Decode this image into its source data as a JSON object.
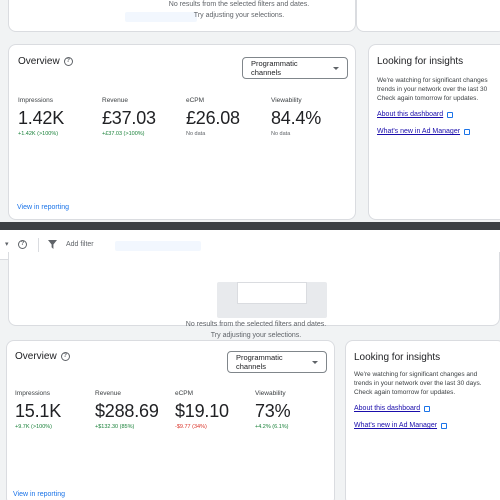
{
  "top": {
    "empty_state": {
      "line1": "No results from the selected filters and dates.",
      "line2": "Try adjusting your selections."
    },
    "overview": {
      "title": "Overview",
      "channel_select": "Programmatic channels",
      "metrics": [
        {
          "label": "Impressions",
          "value": "1.42K",
          "delta": "+1.42K (>100%)",
          "tone": "pos"
        },
        {
          "label": "Revenue",
          "value": "£37.03",
          "delta": "+£37.03 (>100%)",
          "tone": "pos"
        },
        {
          "label": "eCPM",
          "value": "£26.08",
          "delta": "No data",
          "tone": "neutral"
        },
        {
          "label": "Viewability",
          "value": "84.4%",
          "delta": "No data",
          "tone": "neutral"
        }
      ],
      "view_link": "View in reporting"
    },
    "insights": {
      "title": "Looking for insights",
      "text1": "We're watching for significant changes",
      "text2": "trends in your network over the last 30",
      "text3": "Check again tomorrow for updates.",
      "link1": "About this dashboard",
      "link2": "What's new in Ad Manager"
    }
  },
  "bottom": {
    "toolbar": {
      "filter_label": "Add filter"
    },
    "empty_state": {
      "line1": "No results from the selected filters and dates.",
      "line2": "Try adjusting your selections."
    },
    "overview": {
      "title": "Overview",
      "channel_select": "Programmatic channels",
      "metrics": [
        {
          "label": "Impressions",
          "value": "15.1K",
          "delta": "+9.7K (>100%)",
          "tone": "pos"
        },
        {
          "label": "Revenue",
          "value": "$288.69",
          "delta": "+$132.30 (85%)",
          "tone": "pos"
        },
        {
          "label": "eCPM",
          "value": "$19.10",
          "delta": "-$9.77 (34%)",
          "tone": "neg"
        },
        {
          "label": "Viewability",
          "value": "73%",
          "delta": "+4.2% (6.1%)",
          "tone": "pos"
        }
      ],
      "view_link": "View in reporting"
    },
    "insights": {
      "title": "Looking for insights",
      "text1": "We're watching for significant changes and",
      "text2": "trends in your network over the last 30 days.",
      "text3": "Check again tomorrow for updates.",
      "link1": "About this dashboard",
      "link2": "What's new in Ad Manager"
    }
  }
}
